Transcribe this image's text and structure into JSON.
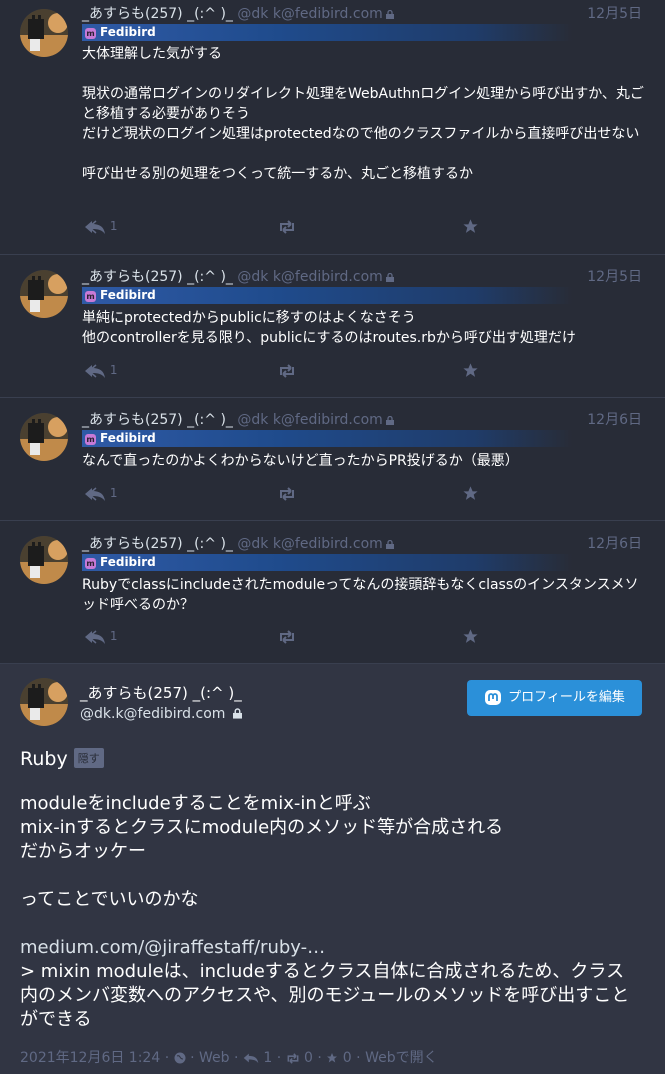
{
  "statuses": [
    {
      "display_name": "_あすらも(257) _(:^ )_",
      "acct": "@dk k@fedibird.com",
      "date": "12月5日",
      "badge": "Fedibird",
      "paragraphs": [
        "大体理解した気がする",
        "現状の通常ログインのリダイレクト処理をWebAuthnログイン処理から呼び出すか、丸ごと移植する必要がありそう\nだけど現状のログイン処理はprotectedなので他のクラスファイルから直接呼び出せない",
        "呼び出せる別の処理をつくって統一するか、丸ごと移植するか"
      ],
      "reply_count": "1"
    },
    {
      "display_name": "_あすらも(257) _(:^ )_",
      "acct": "@dk k@fedibird.com",
      "date": "12月5日",
      "badge": "Fedibird",
      "paragraphs": [
        "単純にprotectedからpublicに移すのはよくなさそう\n他のcontrollerを見る限り、publicにするのはroutes.rbから呼び出す処理だけ"
      ],
      "reply_count": "1"
    },
    {
      "display_name": "_あすらも(257) _(:^ )_",
      "acct": "@dk k@fedibird.com",
      "date": "12月6日",
      "badge": "Fedibird",
      "paragraphs": [
        "なんで直ったのかよくわからないけど直ったからPR投げるか（最悪）"
      ],
      "reply_count": "1"
    },
    {
      "display_name": "_あすらも(257) _(:^ )_",
      "acct": "@dk k@fedibird.com",
      "date": "12月6日",
      "badge": "Fedibird",
      "paragraphs": [
        "Rubyでclassにincludeされたmoduleってなんの接頭辞もなくclassのインスタンスメソッド呼べるのか？"
      ],
      "reply_count": "1"
    }
  ],
  "detail": {
    "display_name": "_あすらも(257) _(:^ )_",
    "acct": "@dk.k@fedibird.com",
    "edit_profile_label": "プロフィールを編集",
    "spoiler_text": "Ruby",
    "spoiler_button": "隠す",
    "paragraphs": [
      "moduleをincludeすることをmix-inと呼ぶ\nmix-inするとクラスにmodule内のメソッド等が合成される\nだからオッケー",
      "ってことでいいのかな"
    ],
    "link_text": "medium.com/@jiraffestaff/ruby-…",
    "quote_text": "> mixin moduleは、includeするとクラス自体に合成されるため、クラス内のメンバ変数へのアクセスや、別のモジュールのメソッドを呼び出すことができる",
    "timestamp": "2021年12月6日 1:24",
    "visibility_label": "Web",
    "reply_count": "1",
    "boost_count": "0",
    "fav_count": "0",
    "open_web_label": "Webで開く"
  },
  "colors": {
    "background": "#282c37",
    "detail_background": "#313543",
    "muted": "#606984",
    "accent": "#2b90d9"
  }
}
